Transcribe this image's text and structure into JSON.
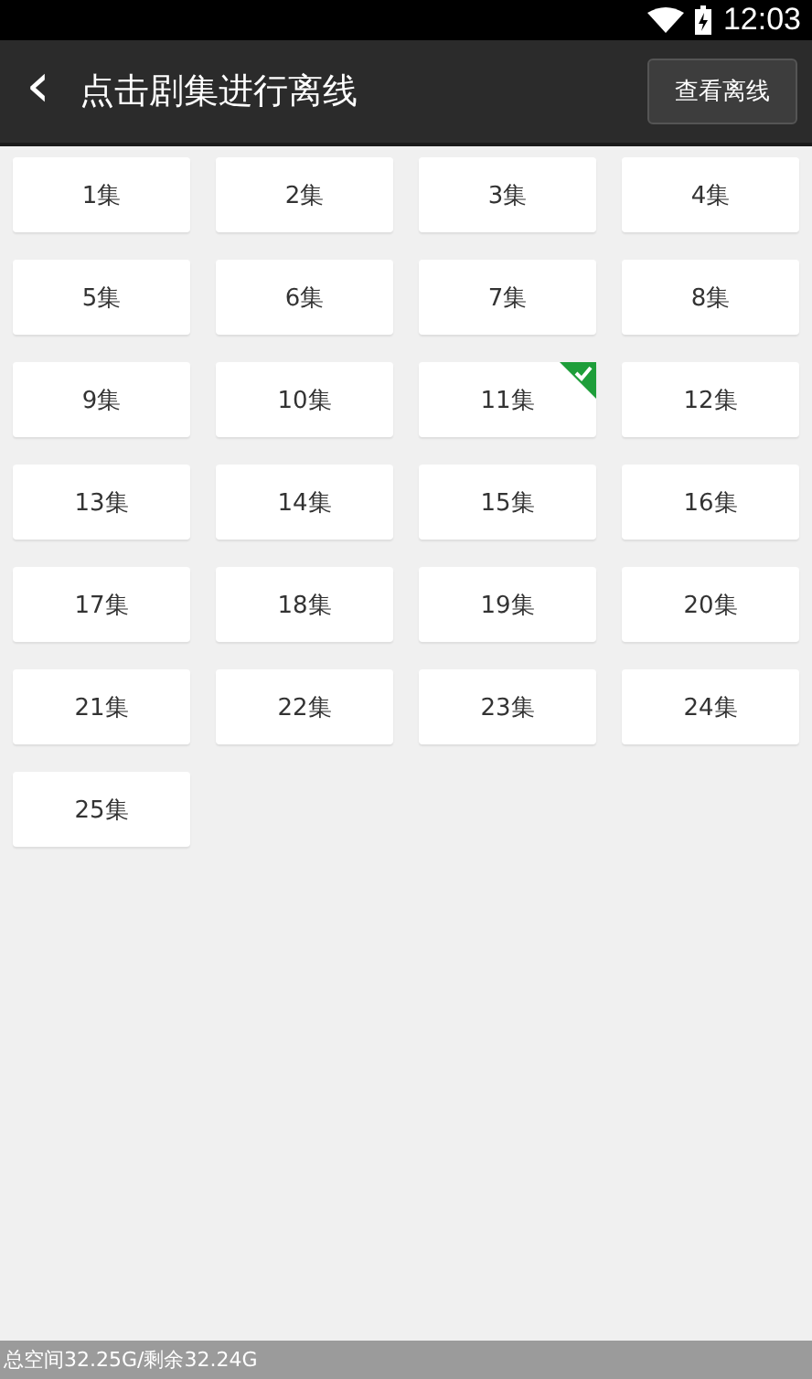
{
  "status_bar": {
    "time": "12:03"
  },
  "header": {
    "back": "‹",
    "title": "点击剧集进行离线",
    "button": "查看离线"
  },
  "episodes": [
    {
      "label": "1集",
      "selected": false
    },
    {
      "label": "2集",
      "selected": false
    },
    {
      "label": "3集",
      "selected": false
    },
    {
      "label": "4集",
      "selected": false
    },
    {
      "label": "5集",
      "selected": false
    },
    {
      "label": "6集",
      "selected": false
    },
    {
      "label": "7集",
      "selected": false
    },
    {
      "label": "8集",
      "selected": false
    },
    {
      "label": "9集",
      "selected": false
    },
    {
      "label": "10集",
      "selected": false
    },
    {
      "label": "11集",
      "selected": true
    },
    {
      "label": "12集",
      "selected": false
    },
    {
      "label": "13集",
      "selected": false
    },
    {
      "label": "14集",
      "selected": false
    },
    {
      "label": "15集",
      "selected": false
    },
    {
      "label": "16集",
      "selected": false
    },
    {
      "label": "17集",
      "selected": false
    },
    {
      "label": "18集",
      "selected": false
    },
    {
      "label": "19集",
      "selected": false
    },
    {
      "label": "20集",
      "selected": false
    },
    {
      "label": "21集",
      "selected": false
    },
    {
      "label": "22集",
      "selected": false
    },
    {
      "label": "23集",
      "selected": false
    },
    {
      "label": "24集",
      "selected": false
    },
    {
      "label": "25集",
      "selected": false
    }
  ],
  "footer": {
    "storage": "总空间32.25G/剩余32.24G"
  }
}
